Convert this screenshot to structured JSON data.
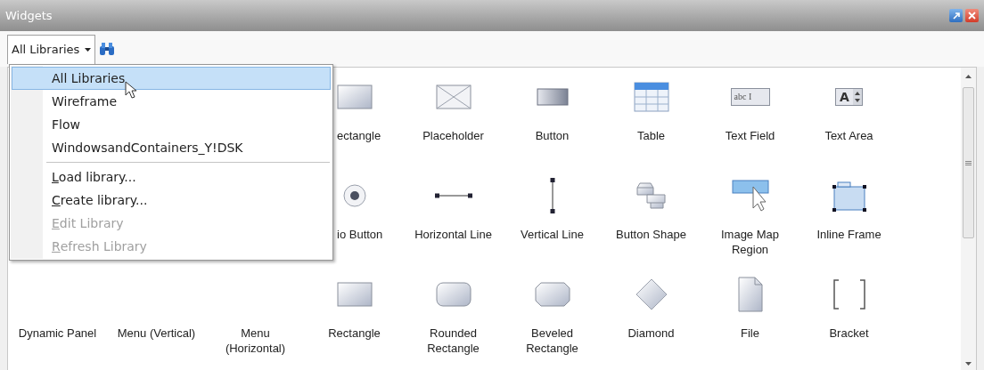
{
  "window": {
    "title": "Widgets"
  },
  "toolbar": {
    "library_dropdown": {
      "label": "All Libraries",
      "open": true
    }
  },
  "library_menu": {
    "items": [
      {
        "label": "All Libraries",
        "selected": true,
        "disabled": false,
        "underline_first": false,
        "separator_before": false
      },
      {
        "label": "Wireframe",
        "selected": false,
        "disabled": false,
        "underline_first": false,
        "separator_before": false
      },
      {
        "label": "Flow",
        "selected": false,
        "disabled": false,
        "underline_first": false,
        "separator_before": false
      },
      {
        "label": "WindowsandContainers_Y!DSK",
        "selected": false,
        "disabled": false,
        "underline_first": false,
        "separator_before": false
      },
      {
        "label": "Load library...",
        "selected": false,
        "disabled": false,
        "underline_first": true,
        "separator_before": true
      },
      {
        "label": "Create library...",
        "selected": false,
        "disabled": false,
        "underline_first": true,
        "separator_before": false
      },
      {
        "label": "Edit Library",
        "selected": false,
        "disabled": true,
        "underline_first": true,
        "separator_before": false
      },
      {
        "label": "Refresh Library",
        "selected": false,
        "disabled": true,
        "underline_first": true,
        "separator_before": false
      }
    ]
  },
  "widget_rows": [
    [
      {
        "label": "ectangle",
        "kind": "rectangle",
        "cut_by_menu": true
      },
      {
        "label": "Placeholder",
        "kind": "placeholder"
      },
      {
        "label": "Button",
        "kind": "button"
      },
      {
        "label": "Table",
        "kind": "table"
      },
      {
        "label": "Text Field",
        "kind": "text-field",
        "icon_text": "abc I"
      },
      {
        "label": "Text Area",
        "kind": "text-area",
        "icon_text": "A"
      }
    ],
    [
      {
        "label": "io Button",
        "kind": "radio-button",
        "cut_by_menu": true
      },
      {
        "label": "Horizontal Line",
        "kind": "horizontal-line"
      },
      {
        "label": "Vertical Line",
        "kind": "vertical-line"
      },
      {
        "label": "Button Shape",
        "kind": "button-shape"
      },
      {
        "label": "Image Map Region",
        "kind": "image-map"
      },
      {
        "label": "Inline Frame",
        "kind": "inline-frame"
      }
    ],
    [
      {
        "label": "Dynamic Panel"
      },
      {
        "label": "Menu (Vertical)"
      },
      {
        "label": "Menu (Horizontal)"
      },
      {
        "label": "Rectangle",
        "kind": "rectangle"
      },
      {
        "label": "Rounded Rectangle",
        "kind": "rounded-rectangle"
      },
      {
        "label": "Beveled Rectangle",
        "kind": "beveled-rectangle"
      },
      {
        "label": "Diamond",
        "kind": "diamond"
      },
      {
        "label": "File",
        "kind": "file"
      },
      {
        "label": "Bracket",
        "kind": "bracket"
      }
    ]
  ]
}
